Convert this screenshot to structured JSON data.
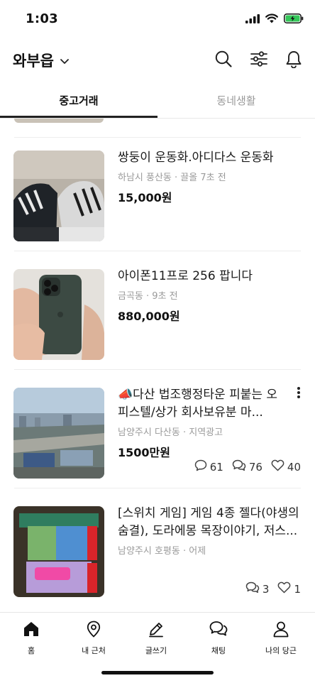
{
  "status_bar": {
    "time": "1:03"
  },
  "header": {
    "location": "와부읍"
  },
  "tabs": [
    {
      "label": "중고거래"
    },
    {
      "label": "동네생활"
    }
  ],
  "items": [
    {
      "title": "쌍둥이 운동화.아디다스 운동화",
      "meta": "하남시 풍산동 · 끌올 7초 전",
      "price": "15,000원"
    },
    {
      "title": "아이폰11프로 256 팝니다",
      "meta": "금곡동 · 9초 전",
      "price": "880,000원"
    },
    {
      "title": "📣다산 법조행정타운 피붙는 오피스텔/상가 회사보유분 마...",
      "meta": "남양주시 다산동 · 지역광고",
      "price": "1500만원",
      "counts": {
        "chat": "61",
        "comment": "76",
        "like": "40"
      }
    },
    {
      "title": "[스위치 게임] 게임 4종 젤다(야생의 숨결), 도라에몽 목장이야기, 저스...",
      "meta": "남양주시 호평동 · 어제",
      "counts": {
        "comment": "3",
        "like": "1"
      }
    }
  ],
  "bottom_nav": [
    {
      "label": "홈",
      "icon": "home-icon"
    },
    {
      "label": "내 근처",
      "icon": "location-pin-icon"
    },
    {
      "label": "글쓰기",
      "icon": "pencil-icon"
    },
    {
      "label": "채팅",
      "icon": "chat-icon"
    },
    {
      "label": "나의 당근",
      "icon": "person-icon"
    }
  ]
}
